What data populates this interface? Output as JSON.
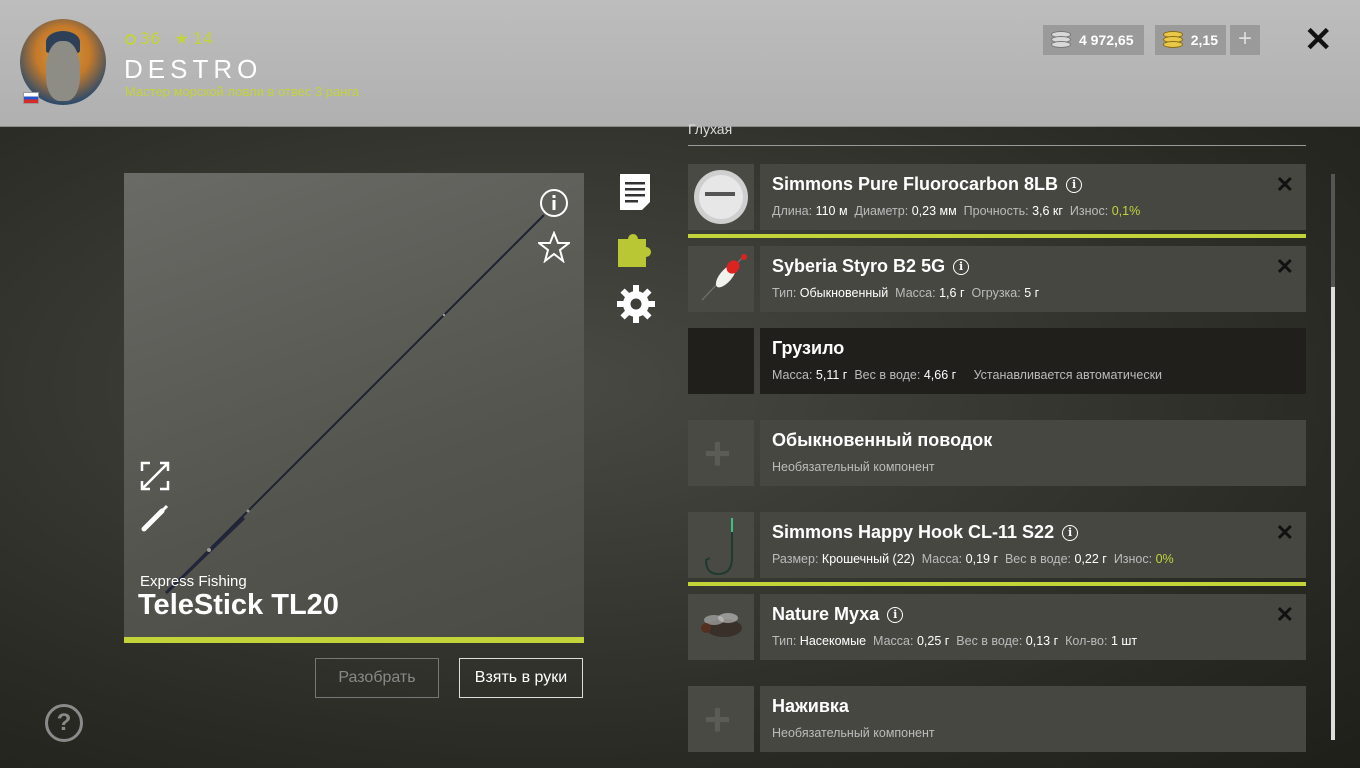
{
  "player": {
    "level": "36",
    "stars": "14",
    "name": "DESTRO",
    "rank": "Мастер морской ловли в отвес 3 ранга"
  },
  "wallet": {
    "silver": "4 972,65",
    "gold": "2,15"
  },
  "rod": {
    "brand": "Express Fishing",
    "model": "TeleStick TL20"
  },
  "buttons": {
    "disassemble": "Разобрать",
    "take": "Взять в руки"
  },
  "section": {
    "label": "Глухая"
  },
  "slots": [
    {
      "title": "Simmons Pure Fluorocarbon 8LB",
      "specs": [
        {
          "k": "Длина:",
          "v": "110 м"
        },
        {
          "k": "Диаметр:",
          "v": "0,23 мм"
        },
        {
          "k": "Прочность:",
          "v": "3,6 кг"
        },
        {
          "k": "Износ:",
          "v": "0,1%"
        }
      ]
    },
    {
      "title": "Syberia Styro B2 5G",
      "specs": [
        {
          "k": "Тип:",
          "v": "Обыкновенный"
        },
        {
          "k": "Масса:",
          "v": "1,6 г"
        },
        {
          "k": "Огрузка:",
          "v": "5 г"
        }
      ]
    },
    {
      "title": "Грузило",
      "specs": [
        {
          "k": "Масса:",
          "v": "5,11 г"
        },
        {
          "k": "Вес в воде:",
          "v": "4,66 г"
        }
      ],
      "note": "Устанавливается автоматически"
    },
    {
      "title": "Обыкновенный поводок",
      "note": "Необязательный компонент"
    },
    {
      "title": "Simmons Happy Hook CL-11 S22",
      "specs": [
        {
          "k": "Размер:",
          "v": "Крошечный (22)"
        },
        {
          "k": "Масса:",
          "v": "0,19 г"
        },
        {
          "k": "Вес в воде:",
          "v": "0,22 г"
        },
        {
          "k": "Износ:",
          "v": "0%"
        }
      ]
    },
    {
      "title": "Nature Муха",
      "specs": [
        {
          "k": "Тип:",
          "v": "Насекомые"
        },
        {
          "k": "Масса:",
          "v": "0,25 г"
        },
        {
          "k": "Вес в воде:",
          "v": "0,13 г"
        },
        {
          "k": "Кол-во:",
          "v": "1 шт"
        }
      ]
    },
    {
      "title": "Наживка",
      "note": "Необязательный компонент"
    }
  ],
  "icons": {
    "level": "ring-icon",
    "stars": "star-icon",
    "close": "close-icon",
    "info": "info-icon",
    "favorite": "star-outline-icon",
    "expand": "expand-icon",
    "paint": "brush-icon",
    "description": "document-icon",
    "components": "puzzle-icon",
    "settings": "gear-icon",
    "help": "help-icon"
  },
  "colors": {
    "accent": "#c2d43a",
    "header_bg": "#b7b7b7"
  }
}
